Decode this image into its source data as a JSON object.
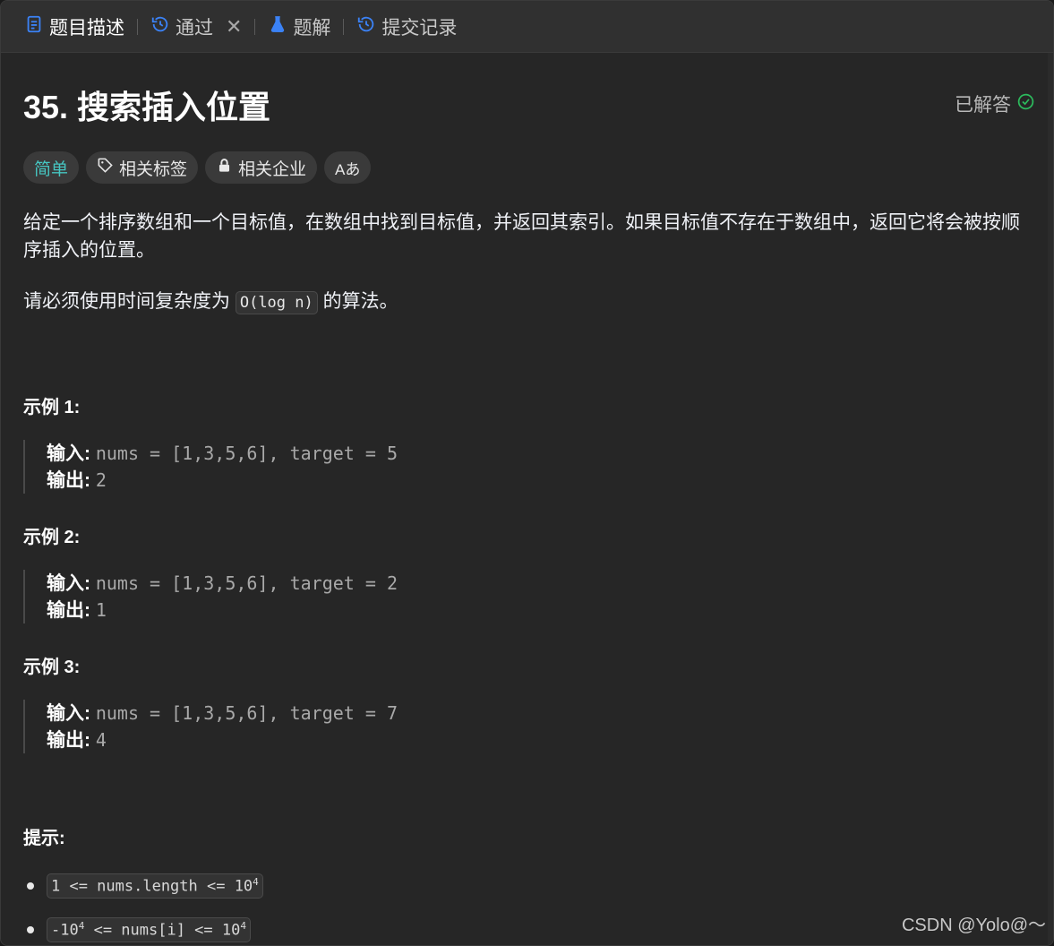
{
  "tabs": [
    {
      "label": "题目描述",
      "icon": "description-icon",
      "active": true
    },
    {
      "label": "通过",
      "icon": "history-icon",
      "closable": true
    },
    {
      "label": "题解",
      "icon": "flask-icon"
    },
    {
      "label": "提交记录",
      "icon": "history-icon"
    }
  ],
  "problem": {
    "title": "35. 搜索插入位置",
    "status": "已解答",
    "tags": [
      "简单",
      "相关标签",
      "相关企业",
      "Aあ"
    ],
    "description_1": "给定一个排序数组和一个目标值，在数组中找到目标值，并返回其索引。如果目标值不存在于数组中，返回它将会被按顺序插入的位置。",
    "description_2_prefix": "请必须使用时间复杂度为",
    "description_2_code": "O(log n)",
    "description_2_suffix": "的算法。"
  },
  "examples": [
    {
      "title": "示例 1:",
      "input_label": "输入:",
      "input": "nums = [1,3,5,6], target = 5",
      "output_label": "输出:",
      "output": "2"
    },
    {
      "title": "示例 2:",
      "input_label": "输入:",
      "input": "nums = [1,3,5,6], target = 2",
      "output_label": "输出:",
      "output": "1"
    },
    {
      "title": "示例 3:",
      "input_label": "输入:",
      "input": "nums = [1,3,5,6], target = 7",
      "output_label": "输出:",
      "output": "4"
    }
  ],
  "hints": {
    "title": "提示:",
    "items": [
      {
        "before": "1 <= nums.length <= 10",
        "sup": "4"
      },
      {
        "before": "-10",
        "sup1": "4",
        "middle": " <= nums[i] <= 10",
        "sup2": "4"
      }
    ]
  },
  "watermark": "CSDN @Yolo@～",
  "colors": {
    "easy": "#46c6c2",
    "solved_check": "#2cbb5d",
    "tab_icon": "#3b82f6"
  }
}
